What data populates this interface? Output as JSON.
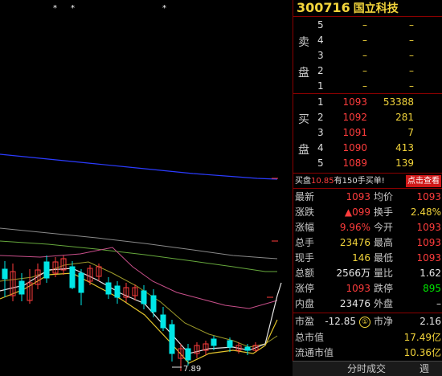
{
  "stock": {
    "code": "300716",
    "name": "国立科技"
  },
  "stars": [
    "*",
    "*",
    "*"
  ],
  "low_label": "7.89",
  "sell_label": [
    "卖",
    "盘"
  ],
  "buy_label": [
    "买",
    "盘"
  ],
  "sell_rows": [
    {
      "n": "5",
      "price": "–",
      "vol": "–"
    },
    {
      "n": "4",
      "price": "–",
      "vol": "–"
    },
    {
      "n": "3",
      "price": "–",
      "vol": "–"
    },
    {
      "n": "2",
      "price": "–",
      "vol": "–"
    },
    {
      "n": "1",
      "price": "–",
      "vol": "–"
    }
  ],
  "buy_rows": [
    {
      "n": "1",
      "price": "1093",
      "vol": "53388"
    },
    {
      "n": "2",
      "price": "1092",
      "vol": "281"
    },
    {
      "n": "3",
      "price": "1091",
      "vol": "7"
    },
    {
      "n": "4",
      "price": "1090",
      "vol": "413"
    },
    {
      "n": "5",
      "price": "1089",
      "vol": "139"
    }
  ],
  "notice": {
    "pre": "买盘",
    "price": "10.85",
    "post": "有150手买单!",
    "button": "点击查看"
  },
  "quotes": [
    {
      "l1": "最新",
      "v1": "1093",
      "c1": "red",
      "l2": "均价",
      "v2": "1093",
      "c2": "red"
    },
    {
      "l1": "涨跌",
      "v1": "▲099",
      "c1": "red",
      "l2": "换手",
      "v2": "2.48%",
      "c2": "ylw"
    },
    {
      "l1": "涨幅",
      "v1": "9.96%",
      "c1": "red",
      "l2": "今开",
      "v2": "1093",
      "c2": "red"
    },
    {
      "l1": "总手",
      "v1": "23476",
      "c1": "ylw",
      "l2": "最高",
      "v2": "1093",
      "c2": "red"
    },
    {
      "l1": "现手",
      "v1": "146",
      "c1": "ylw",
      "l2": "最低",
      "v2": "1093",
      "c2": "red"
    },
    {
      "l1": "总额",
      "v1": "2566万",
      "c1": "wht",
      "l2": "量比",
      "v2": "1.62",
      "c2": "wht"
    },
    {
      "l1": "涨停",
      "v1": "1093",
      "c1": "red",
      "l2": "跌停",
      "v2": "895",
      "c2": "grn"
    },
    {
      "l1": "内盘",
      "v1": "23476",
      "c1": "wht",
      "l2": "外盘",
      "v2": "–",
      "c2": "wht"
    }
  ],
  "pe": {
    "l1": "市盈",
    "v1": "-12.85",
    "circle": "①",
    "l2": "市净",
    "v2": "2.16"
  },
  "bottom": [
    {
      "label": "总市值",
      "value": "17.49亿"
    },
    {
      "label": "流通市值",
      "value": "10.36亿"
    }
  ],
  "tabs": {
    "left": "分时成交",
    "right": "週"
  },
  "colors": {
    "up": "#ff3c3c",
    "down": "#00e6e6",
    "accent": "#f2d43b",
    "divider": "#8b0000"
  }
}
